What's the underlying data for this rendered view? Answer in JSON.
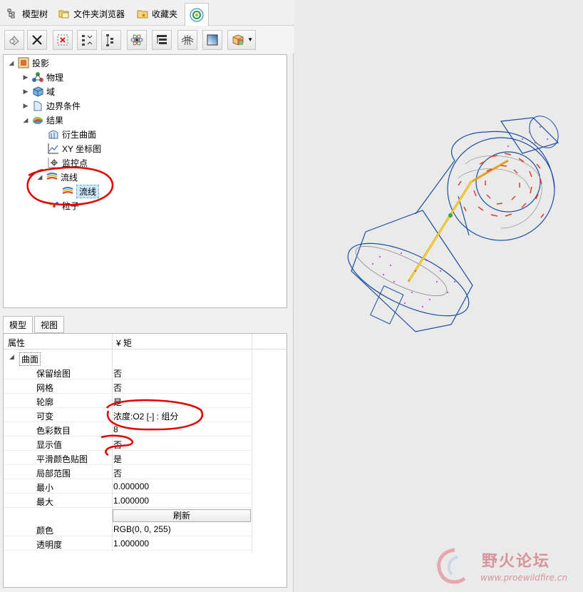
{
  "tabs": {
    "model_tree": "模型树",
    "folder_browser": "文件夹浏览器",
    "favorites": "收藏夹"
  },
  "toolbar": {
    "buttons": [
      "shape-icon",
      "delete-icon",
      "remove-icon",
      "collapse-icon",
      "expand-icon",
      "physics-icon",
      "list-icon",
      "mesh-icon",
      "gradient-icon",
      "cube-icon"
    ]
  },
  "tree": {
    "root": "投影",
    "physics": "物理",
    "domain": "域",
    "boundary": "边界条件",
    "results": "结果",
    "derived_surface": "衍生曲面",
    "xy_plot": "XY 坐标图",
    "monitor_points": "监控点",
    "streamline_group": "流线",
    "streamline_item": "流线",
    "particles": "粒子"
  },
  "property_tabs": {
    "model": "模型",
    "view": "视图"
  },
  "properties": {
    "header_name": "属性",
    "header_value": "¥ 矩",
    "group": "曲面",
    "rows": [
      {
        "name": "保留绘图",
        "value": "否"
      },
      {
        "name": "网格",
        "value": "否"
      },
      {
        "name": "轮廓",
        "value": "是"
      },
      {
        "name": "可变",
        "value": "浓度:O2 [-] : 组分"
      },
      {
        "name": "色彩数目",
        "value": "8"
      },
      {
        "name": "显示值",
        "value": "否"
      },
      {
        "name": "平滑颜色贴图",
        "value": "是"
      },
      {
        "name": "局部范围",
        "value": "否"
      },
      {
        "name": "最小",
        "value": "0.000000"
      },
      {
        "name": "最大",
        "value": "1.000000"
      }
    ],
    "refresh_label": "刷新",
    "color_name": "颜色",
    "color_value": "RGB(0, 0, 255)",
    "opacity_name": "透明度",
    "opacity_value": "1.000000"
  },
  "watermark": {
    "title": "野火论坛",
    "url": "www.proewildfire.cn"
  },
  "colors": {
    "annotation": "#e00000",
    "model_edge": "#1a4fa0",
    "streamline_red": "#e03a2a",
    "particle_magenta": "#d21ed2"
  }
}
